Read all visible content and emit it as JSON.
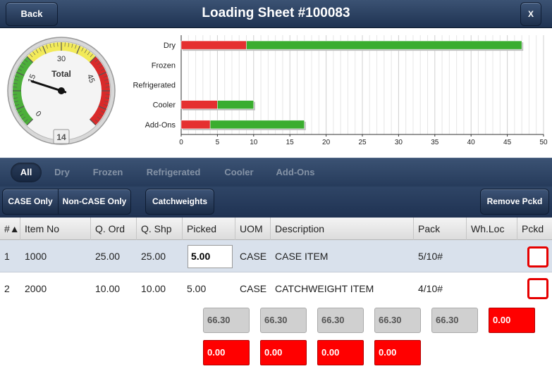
{
  "header": {
    "back_label": "Back",
    "title": "Loading Sheet #100083",
    "close_label": "X"
  },
  "gauge": {
    "label": "Total",
    "value": 14,
    "scale_labels": [
      "0",
      "15",
      "30",
      "45"
    ],
    "needle_value": 14
  },
  "chart_data": {
    "type": "bar",
    "orientation": "horizontal",
    "stacked": true,
    "categories": [
      "Dry",
      "Frozen",
      "Refrigerated",
      "Cooler",
      "Add-Ons"
    ],
    "series": [
      {
        "color": "#e53030",
        "values": [
          9,
          0,
          0,
          5,
          4
        ]
      },
      {
        "color": "#3aad2f",
        "values": [
          38,
          0,
          0,
          5,
          13
        ]
      }
    ],
    "xlim": [
      0,
      50
    ],
    "xticks": [
      "0",
      "5",
      "10",
      "15",
      "20",
      "25",
      "30",
      "35",
      "40",
      "45",
      "50"
    ],
    "grid": true
  },
  "filters": [
    "All",
    "Dry",
    "Frozen",
    "Refrigerated",
    "Cooler",
    "Add-Ons"
  ],
  "actions": {
    "case_only": "CASE Only",
    "non_case_only": "Non-CASE Only",
    "catchweights": "Catchweights",
    "remove_pckd": "Remove Pckd"
  },
  "table": {
    "columns": [
      "#▲",
      "Item No",
      "Q. Ord",
      "Q. Shp",
      "Picked",
      "UOM",
      "Description",
      "Pack",
      "Wh.Loc",
      "Pckd"
    ],
    "rows": [
      {
        "num": "1",
        "item": "1000",
        "qord": "25.00",
        "qshp": "25.00",
        "picked": "5.00",
        "uom": "CASE",
        "desc": "CASE ITEM",
        "pack": "5/10#",
        "whloc": ""
      },
      {
        "num": "2",
        "item": "2000",
        "qord": "10.00",
        "qshp": "10.00",
        "picked": "5.00",
        "uom": "CASE",
        "desc": "CATCHWEIGHT ITEM",
        "pack": "4/10#",
        "whloc": ""
      }
    ]
  },
  "catchweights": {
    "gray": [
      "66.30",
      "66.30",
      "66.30",
      "66.30",
      "66.30"
    ],
    "red_row1": [
      "0.00"
    ],
    "red_row2": [
      "0.00",
      "0.00",
      "0.00",
      "0.00"
    ]
  }
}
